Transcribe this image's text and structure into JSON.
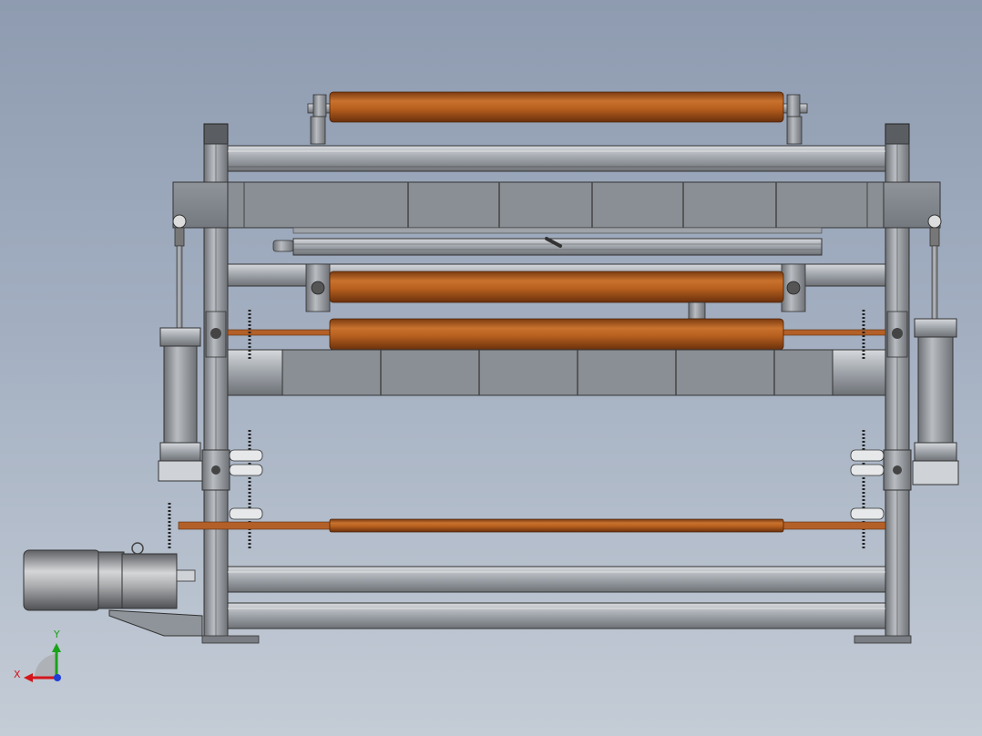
{
  "view": {
    "kind": "cad-3d-viewport",
    "background_top": "#8e9bb0",
    "background_bottom": "#c4ccd6"
  },
  "colors": {
    "frame": "#9a9fa6",
    "frame_dark": "#4a4d52",
    "roller": "#b8601f",
    "roller_dark": "#7a3a10",
    "motor": "#a9abad",
    "axis_x": "#d4161b",
    "axis_y": "#1aa21a",
    "axis_z": "#1f3fd6"
  },
  "parts": [
    "top-roller",
    "upper-frame-beam",
    "upper-cover-plate",
    "rod-beam",
    "middle-upper-roller",
    "middle-lower-roller",
    "middle-cover-plate",
    "left-cylinder",
    "right-cylinder",
    "lower-shaft",
    "bottom-beams",
    "drive-motor",
    "gear-sprockets"
  ],
  "triad": {
    "x_label": "X",
    "y_label": "Y"
  }
}
